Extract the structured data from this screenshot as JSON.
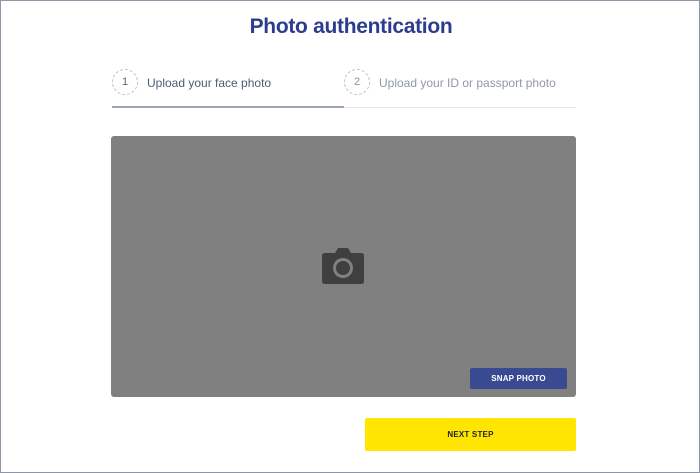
{
  "page": {
    "title": "Photo authentication"
  },
  "steps": [
    {
      "number": "1",
      "label": "Upload your face photo",
      "active": true
    },
    {
      "number": "2",
      "label": "Upload your ID or passport photo",
      "active": false
    }
  ],
  "camera": {
    "icon": "camera-icon",
    "snap_label": "SNAP PHOTO"
  },
  "actions": {
    "next_label": "NEXT STEP"
  },
  "colors": {
    "title": "#2d3d8e",
    "snap_button": "#3a4a92",
    "next_button": "#ffe500",
    "camera_bg": "#808080"
  }
}
